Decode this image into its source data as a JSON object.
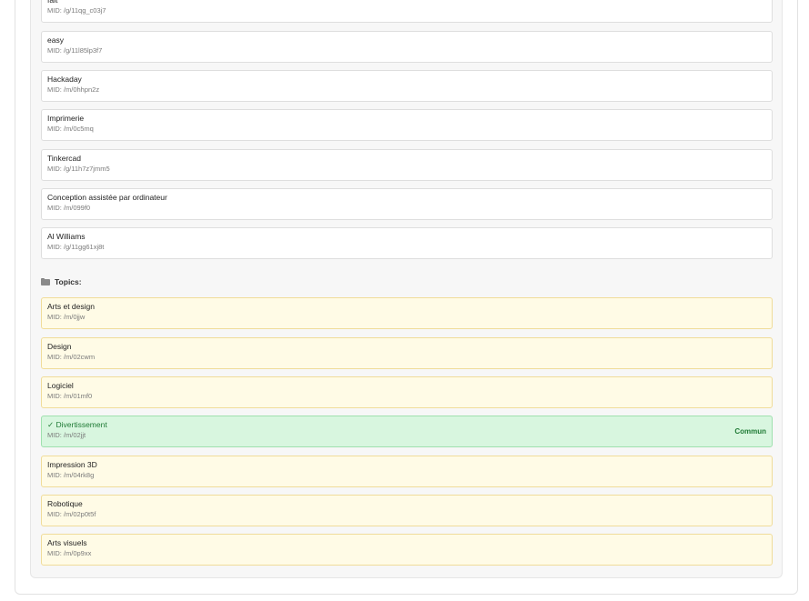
{
  "entities": [
    {
      "name": "fait",
      "mid": "MID: /g/11qg_c03j7"
    },
    {
      "name": "easy",
      "mid": "MID: /g/11l85lp3f7"
    },
    {
      "name": "Hackaday",
      "mid": "MID: /m/0hhpn2z"
    },
    {
      "name": "Imprimerie",
      "mid": "MID: /m/0c5mq"
    },
    {
      "name": "Tinkercad",
      "mid": "MID: /g/11h7z7jmm5"
    },
    {
      "name": "Conception assistée par ordinateur",
      "mid": "MID: /m/099f0"
    },
    {
      "name": "Al Williams",
      "mid": "MID: /g/11gg61xj8t"
    }
  ],
  "topics_section": {
    "icon": "folder-icon",
    "title": "Topics:"
  },
  "topics": [
    {
      "name": "Arts et design",
      "mid": "MID: /m/0jjw"
    },
    {
      "name": "Design",
      "mid": "MID: /m/02cwm"
    },
    {
      "name": "Logiciel",
      "mid": "MID: /m/01mf0"
    },
    {
      "name": "✓ Divertissement",
      "mid": "MID: /m/02jjt",
      "badge": "Commun"
    },
    {
      "name": "Impression 3D",
      "mid": "MID: /m/04rk8g"
    },
    {
      "name": "Robotique",
      "mid": "MID: /m/02p0t5f"
    },
    {
      "name": "Arts visuels",
      "mid": "MID: /m/0p9xx"
    }
  ],
  "colors": {
    "topic_bg": "#fffbe6",
    "common_bg": "#d8f6df",
    "common_text": "#1f7a35"
  }
}
